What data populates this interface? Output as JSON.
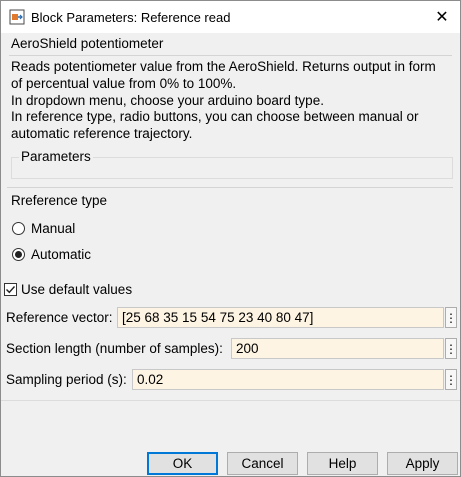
{
  "window": {
    "title": "Block Parameters: Reference read",
    "close_symbol": "✕",
    "app_icon": "simulink-block-icon"
  },
  "mask": {
    "section_title": "AeroShield potentiometer",
    "description_lines": [
      "Reads potentiometer value from the AeroShield. Returns output in form",
      "of percentual value from 0% to 100%.",
      "In dropdown menu, choose your arduino board type.",
      "In reference type, radio buttons, you can choose between manual or",
      "automatic reference trajectory."
    ]
  },
  "parameters": {
    "group_title": "Parameters"
  },
  "reference_type": {
    "group_title": "Rreference type",
    "options": [
      {
        "label": "Manual",
        "selected": false
      },
      {
        "label": "Automatic",
        "selected": true
      }
    ]
  },
  "use_default": {
    "label": "Use default values",
    "checked": true
  },
  "fields": [
    {
      "label": "Reference vector:",
      "value": "[25 68 35 15 54 75 23 40 80 47]"
    },
    {
      "label": "Section length (number of samples):",
      "value": "200"
    },
    {
      "label": "Sampling period (s):",
      "value": "0.02"
    }
  ],
  "field_menu_symbol": "⋮",
  "buttons": {
    "ok": "OK",
    "cancel": "Cancel",
    "help": "Help",
    "apply": "Apply"
  }
}
